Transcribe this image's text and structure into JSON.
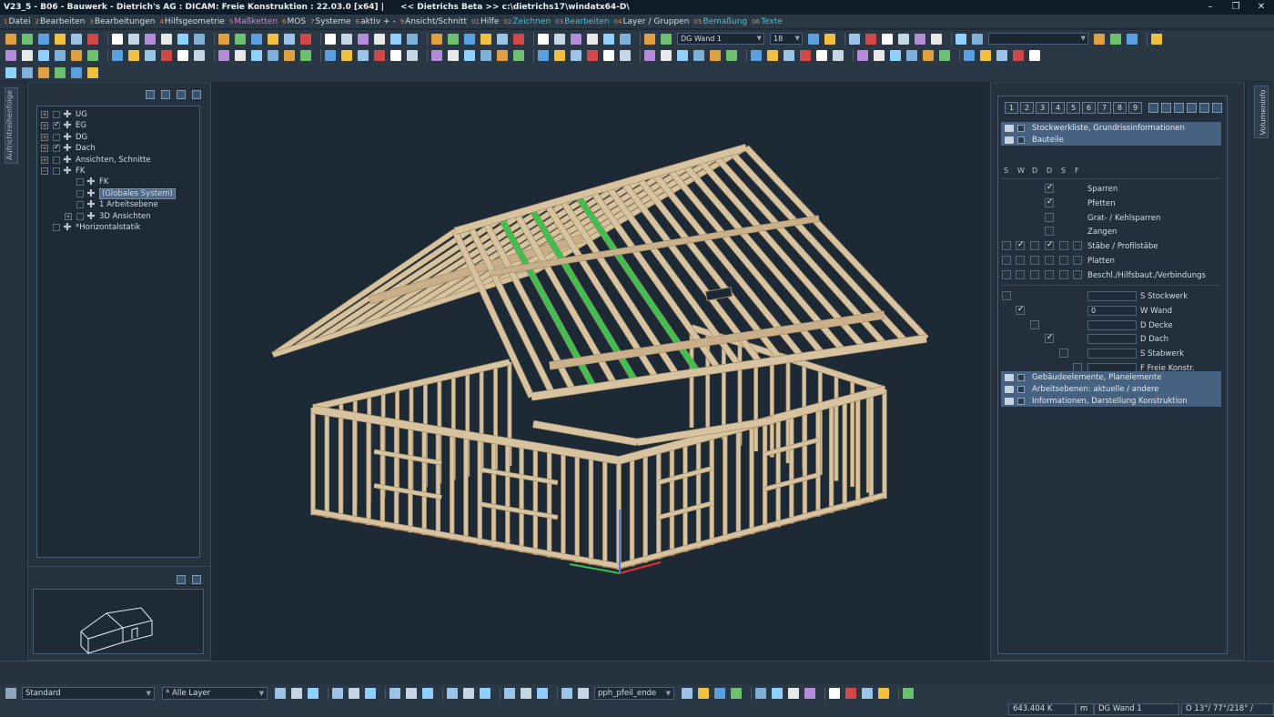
{
  "window": {
    "title": "V23_5 - B06 - Bauwerk - Dietrich's AG : DICAM: Freie Konstruktion : 22.03.0 [x64] |",
    "path": "<< Dietrichs Beta >> c:\\dietrichs17\\windatx64-D\\",
    "minimize": "–",
    "restore": "❐",
    "close": "✕"
  },
  "menu": [
    {
      "num": "1",
      "label": "Datei",
      "style": "normal"
    },
    {
      "num": "2",
      "label": "Bearbeiten",
      "style": "normal"
    },
    {
      "num": "3",
      "label": "Bearbeitungen",
      "style": "normal"
    },
    {
      "num": "4",
      "label": "Hilfsgeometrie",
      "style": "normal"
    },
    {
      "num": "5",
      "label": "Maßketten",
      "style": "pink"
    },
    {
      "num": "6",
      "label": "MOS",
      "style": "normal"
    },
    {
      "num": "7",
      "label": "Systeme",
      "style": "normal"
    },
    {
      "num": "8",
      "label": "aktiv + -",
      "style": "normal"
    },
    {
      "num": "9",
      "label": "Ansicht/Schnitt",
      "style": "normal"
    },
    {
      "num": "01",
      "label": "Hilfe",
      "style": "normal"
    },
    {
      "num": "02",
      "label": "Zeichnen",
      "style": "cyan"
    },
    {
      "num": "03",
      "label": "Bearbeiten",
      "style": "cyan"
    },
    {
      "num": "04",
      "label": "Layer / Gruppen",
      "style": "normal"
    },
    {
      "num": "05",
      "label": "Bemaßung",
      "style": "cyan"
    },
    {
      "num": "06",
      "label": "Texte",
      "style": "cyan"
    }
  ],
  "toolbar": {
    "layer_combo": "DG Wand 1",
    "size_combo": "18"
  },
  "left_panel": {
    "vertical_tab": "Aufrichtreihenfolge",
    "tree": [
      {
        "label": "UG",
        "expander": "+",
        "checked": false,
        "indent": 0
      },
      {
        "label": "EG",
        "expander": "+",
        "checked": true,
        "indent": 0
      },
      {
        "label": "DG",
        "expander": "+",
        "checked": false,
        "indent": 0
      },
      {
        "label": "Dach",
        "expander": "+",
        "checked": true,
        "indent": 0
      },
      {
        "label": "Ansichten, Schnitte",
        "expander": "+",
        "checked": false,
        "indent": 0
      },
      {
        "label": "FK",
        "expander": "−",
        "checked": false,
        "indent": 0
      },
      {
        "label": "FK",
        "expander": "",
        "checked": false,
        "indent": 1
      },
      {
        "label": "(Globales System)",
        "expander": "",
        "checked": false,
        "indent": 1,
        "selected": true
      },
      {
        "label": "1 Arbeitsebene",
        "expander": "",
        "checked": false,
        "indent": 1
      },
      {
        "label": "3D Ansichten",
        "expander": "+",
        "checked": false,
        "indent": 1
      },
      {
        "label": "*Horizontalstatik",
        "expander": "",
        "checked": false,
        "indent": 0
      }
    ]
  },
  "right_panel": {
    "vertical_tab": "Volumeninfo",
    "num_tabs": [
      "1",
      "2",
      "3",
      "4",
      "5",
      "6",
      "7",
      "8",
      "9"
    ],
    "groups_top": [
      "Stockwerkliste, Grundrissinformationen",
      "Bauteile"
    ],
    "col_headers": [
      "S",
      "W",
      "D",
      "D",
      "S",
      "F"
    ],
    "parts": [
      {
        "label": "Sparren",
        "checks": [
          null,
          null,
          null,
          true,
          null,
          null
        ]
      },
      {
        "label": "Pfetten",
        "checks": [
          null,
          null,
          null,
          true,
          null,
          null
        ]
      },
      {
        "label": "Grat- / Kehlsparren",
        "checks": [
          null,
          null,
          null,
          false,
          null,
          null
        ]
      },
      {
        "label": "Zangen",
        "checks": [
          null,
          null,
          null,
          false,
          null,
          null
        ]
      },
      {
        "label": "Stäbe / Profilstäbe",
        "checks": [
          false,
          true,
          false,
          true,
          false,
          false
        ]
      },
      {
        "label": "Platten",
        "checks": [
          false,
          false,
          false,
          false,
          false,
          false
        ]
      },
      {
        "label": "Beschl./Hilfsbaut./Verbindungs",
        "checks": [
          false,
          false,
          false,
          false,
          false,
          false
        ]
      }
    ],
    "storeys": [
      {
        "label": "S Stockwerk",
        "value": "",
        "col": 0,
        "checked": false
      },
      {
        "label": "W Wand",
        "value": "0",
        "col": 1,
        "checked": true
      },
      {
        "label": "D Decke",
        "value": "",
        "col": 2,
        "checked": false
      },
      {
        "label": "D Dach",
        "value": "",
        "col": 3,
        "checked": true
      },
      {
        "label": "S Stabwerk",
        "value": "",
        "col": 4,
        "checked": false
      },
      {
        "label": "F Freie Konstr.",
        "value": "",
        "col": 5,
        "checked": false
      }
    ],
    "groups_bottom": [
      "Gebäudeelemente, Planelemente",
      "Arbeitsebenen: aktuelle / andere",
      "Informationen, Darstellung Konstruktion"
    ]
  },
  "bottom_bar": {
    "style_combo": "Standard",
    "layer_combo": "* Alle Layer",
    "arrow_combo": "pph_pfeil_ende"
  },
  "status": {
    "coord": "643.404 K",
    "unit": "m",
    "layer": "DG Wand 1",
    "view": "O 13°/ 77°/218° /"
  },
  "colors": {
    "timber": "#d8c3a0",
    "timber_dark": "#a08a66",
    "accent_green": "#3fbf4f",
    "axis_red": "#e03030",
    "axis_blue": "#4a7ef0"
  }
}
